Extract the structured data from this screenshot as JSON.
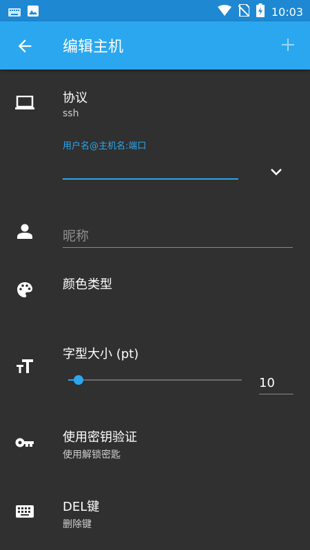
{
  "status_bar": {
    "time": "10:03",
    "icons": [
      "keyboard-icon",
      "image-icon",
      "wifi-icon",
      "no-sim-icon",
      "battery-icon"
    ]
  },
  "appbar": {
    "title": "编辑主机",
    "back_icon": "arrow-back-icon",
    "add_icon": "plus-icon"
  },
  "protocol": {
    "label": "协议",
    "value": "ssh",
    "icon": "laptop-icon"
  },
  "host_field": {
    "floating_label": "用户名@主机名:端口",
    "value": "",
    "dropdown_icon": "chevron-down-icon"
  },
  "nickname": {
    "placeholder": "昵称",
    "value": "",
    "icon": "person-icon"
  },
  "color": {
    "label": "颜色类型",
    "icon": "palette-icon"
  },
  "font_size": {
    "label": "字型大小 (pt)",
    "value": "10",
    "slider_level": 0.06,
    "icon": "text-size-icon"
  },
  "pubkey": {
    "label": "使用密钥验证",
    "value": "使用解锁密匙",
    "icon": "key-icon"
  },
  "del_key": {
    "label": "DEL键",
    "value": "删除键",
    "icon": "keyboard-icon"
  },
  "colors": {
    "accent": "#2aa7ef",
    "status_bar": "#1e88d2",
    "background": "#303030"
  }
}
